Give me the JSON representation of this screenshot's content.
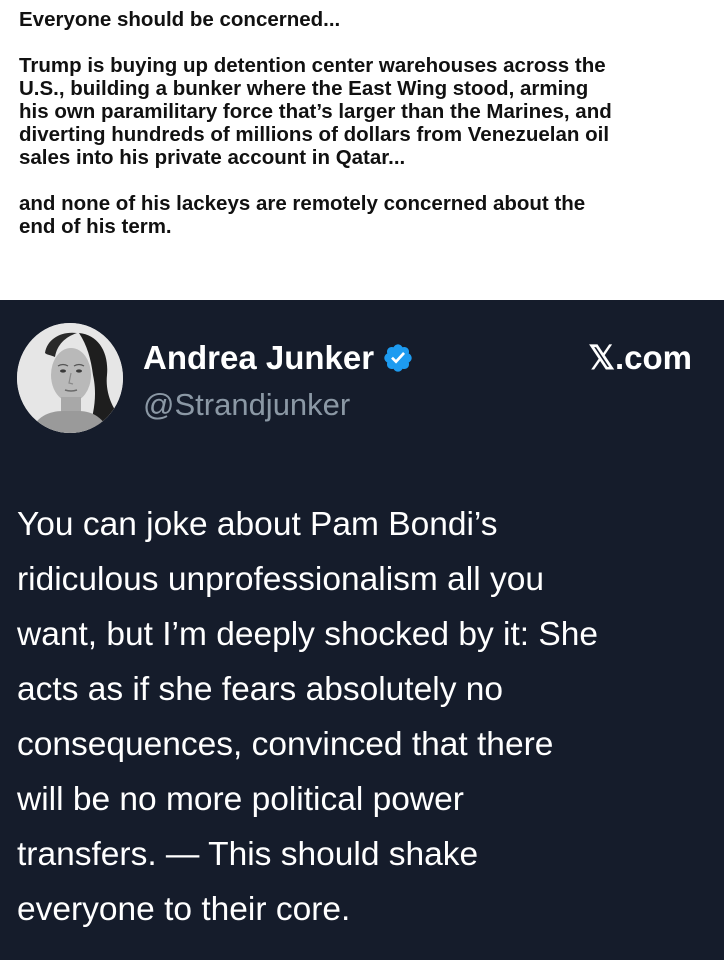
{
  "caption": {
    "line1": "Everyone should be concerned...",
    "paragraph2_lines": [
      "Trump is buying up detention center warehouses across the",
      "U.S., building a bunker where the East Wing stood, arming",
      "his own paramilitary force that’s larger than the Marines, and",
      "diverting hundreds of millions of dollars from Venezuelan oil",
      "sales into his private account in Qatar..."
    ],
    "paragraph3_lines": [
      "and none of his lackeys are remotely concerned about the",
      "end of his term."
    ]
  },
  "tweet": {
    "display_name": "Andrea Junker",
    "handle": "@Strandjunker",
    "site": "𝕏.com",
    "verified_icon": "verified-badge-icon",
    "body_lines": [
      "You can joke about Pam Bondi’s",
      "ridiculous unprofessionalism all you",
      "want, but I’m deeply shocked by it: She",
      "acts as if she fears absolutely no",
      "consequences, convinced that there",
      "will be no more political power",
      "transfers. — This should shake",
      "everyone to their core."
    ]
  },
  "colors": {
    "tweet_background": "#151c2b",
    "handle_gray": "#8b98a5",
    "verified_blue": "#1d9bf0"
  }
}
